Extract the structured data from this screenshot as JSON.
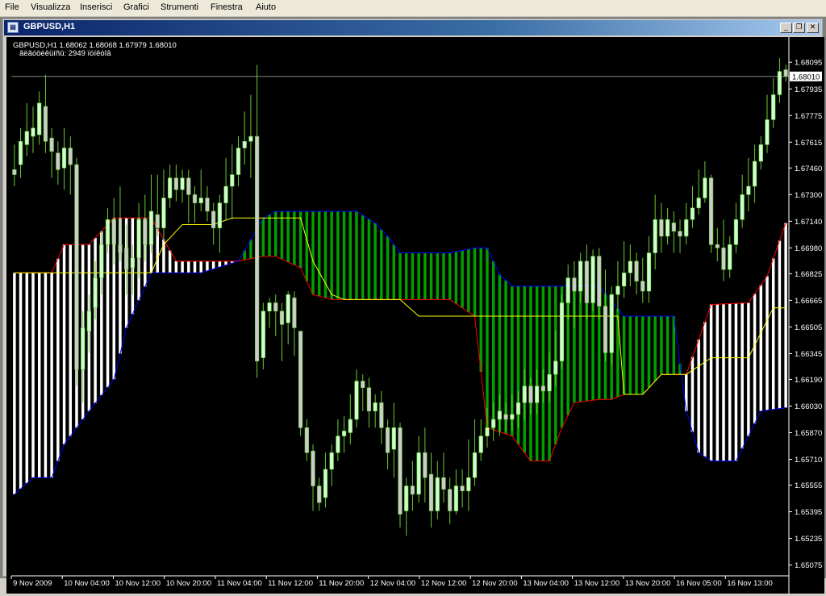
{
  "menu": {
    "items": [
      "File",
      "Visualizza",
      "Inserisci",
      "Grafici",
      "Strumenti",
      "Finestra",
      "Aiuto"
    ]
  },
  "window": {
    "title": "GBPUSD,H1",
    "icon": "chart-window-icon",
    "buttons": [
      {
        "name": "minimize-button",
        "glyph": "_"
      },
      {
        "name": "restore-button",
        "glyph": "❐"
      },
      {
        "name": "close-button",
        "glyph": "✕"
      }
    ]
  },
  "chart_data": {
    "type": "candlestick",
    "symbol": "GBPUSD,H1",
    "ohlc_label": "GBPUSD,H1  1.68062 1.68068 1.67979 1.68010",
    "info_label": "ãëãóöèêüíñû:  2949  ïóíêòîâ",
    "current_price": "1.68010",
    "price_ticks": [
      "1.68095",
      "1.67935",
      "1.67775",
      "1.67615",
      "1.67460",
      "1.67300",
      "1.67140",
      "1.66980",
      "1.66825",
      "1.66665",
      "1.66505",
      "1.66345",
      "1.66190",
      "1.66030",
      "1.65870",
      "1.65710",
      "1.65555",
      "1.65395",
      "1.65235",
      "1.65075"
    ],
    "time_ticks": [
      "9 Nov 2009",
      "10 Nov 04:00",
      "10 Nov 12:00",
      "10 Nov 20:00",
      "11 Nov 04:00",
      "11 Nov 12:00",
      "11 Nov 20:00",
      "12 Nov 04:00",
      "12 Nov 12:00",
      "12 Nov 20:00",
      "13 Nov 04:00",
      "13 Nov 12:00",
      "13 Nov 20:00",
      "16 Nov 05:00",
      "16 Nov 13:00"
    ],
    "ylim": [
      1.6501,
      1.6813
    ],
    "colors": {
      "background": "#000000",
      "bull_candle": "#ccffcc",
      "bear_candle": "#cccccc",
      "wick": "#66cc33",
      "cloud_bull_fill": "#00a000",
      "cloud_bull_edge": "#0000ff",
      "cloud_bear_fill": "#ffffff",
      "cloud_bear_edge": "#ff0000",
      "tenkan": "#ffff00",
      "axis_text": "#ffffff",
      "price_line": "#808080"
    },
    "ichimoku": {
      "tenkan": [
        [
          0,
          1.6683
        ],
        [
          6,
          1.6683
        ],
        [
          12,
          1.6683
        ],
        [
          18,
          1.6683
        ],
        [
          22,
          1.6683
        ],
        [
          24,
          1.67
        ],
        [
          27,
          1.6712
        ],
        [
          32,
          1.6712
        ],
        [
          35,
          1.6716
        ],
        [
          38,
          1.6716
        ],
        [
          42,
          1.6716
        ],
        [
          46,
          1.6716
        ],
        [
          48,
          1.669
        ],
        [
          51,
          1.667
        ],
        [
          53,
          1.6667
        ],
        [
          58,
          1.6667
        ],
        [
          62,
          1.6667
        ],
        [
          65,
          1.6657
        ],
        [
          70,
          1.6657
        ],
        [
          75,
          1.6657
        ],
        [
          80,
          1.6657
        ],
        [
          85,
          1.6657
        ],
        [
          88,
          1.6657
        ],
        [
          92,
          1.6657
        ],
        [
          95,
          1.6657
        ],
        [
          97,
          1.6657
        ],
        [
          98,
          1.661
        ],
        [
          101,
          1.661
        ],
        [
          104,
          1.6622
        ],
        [
          108,
          1.6622
        ],
        [
          112,
          1.6632
        ],
        [
          118,
          1.6632
        ],
        [
          122,
          1.6662
        ],
        [
          124,
          1.6662
        ]
      ],
      "span_a": [
        [
          0,
          1.6683
        ],
        [
          6,
          1.6683
        ],
        [
          8,
          1.67
        ],
        [
          12,
          1.67
        ],
        [
          16,
          1.6716
        ],
        [
          22,
          1.6716
        ],
        [
          26,
          1.669
        ],
        [
          30,
          1.669
        ],
        [
          36,
          1.669
        ],
        [
          40,
          1.6693
        ],
        [
          42,
          1.6693
        ],
        [
          46,
          1.6686
        ],
        [
          48,
          1.667
        ],
        [
          51,
          1.6667
        ],
        [
          54,
          1.6667
        ],
        [
          58,
          1.6667
        ],
        [
          62,
          1.6667
        ],
        [
          66,
          1.6667
        ],
        [
          70,
          1.6667
        ],
        [
          74,
          1.6657
        ],
        [
          76,
          1.659
        ],
        [
          80,
          1.6585
        ],
        [
          83,
          1.657
        ],
        [
          86,
          1.657
        ],
        [
          88,
          1.659
        ],
        [
          90,
          1.6605
        ],
        [
          94,
          1.6607
        ],
        [
          96,
          1.6607
        ],
        [
          98,
          1.661
        ],
        [
          101,
          1.661
        ],
        [
          104,
          1.6622
        ],
        [
          108,
          1.6622
        ],
        [
          112,
          1.6664
        ],
        [
          118,
          1.6665
        ],
        [
          121,
          1.6681
        ],
        [
          124,
          1.6713
        ]
      ],
      "span_b": [
        [
          0,
          1.655
        ],
        [
          3,
          1.656
        ],
        [
          6,
          1.656
        ],
        [
          8,
          1.658
        ],
        [
          12,
          1.66
        ],
        [
          16,
          1.6619
        ],
        [
          18,
          1.665
        ],
        [
          22,
          1.6683
        ],
        [
          26,
          1.6683
        ],
        [
          30,
          1.6683
        ],
        [
          36,
          1.669
        ],
        [
          40,
          1.6716
        ],
        [
          42,
          1.672
        ],
        [
          46,
          1.672
        ],
        [
          50,
          1.672
        ],
        [
          55,
          1.672
        ],
        [
          58,
          1.6713
        ],
        [
          60,
          1.6705
        ],
        [
          62,
          1.6695
        ],
        [
          66,
          1.6695
        ],
        [
          70,
          1.6695
        ],
        [
          74,
          1.6698
        ],
        [
          76,
          1.6698
        ],
        [
          78,
          1.6682
        ],
        [
          80,
          1.6675
        ],
        [
          86,
          1.6675
        ],
        [
          90,
          1.6675
        ],
        [
          94,
          1.6675
        ],
        [
          98,
          1.6657
        ],
        [
          104,
          1.6657
        ],
        [
          106,
          1.6657
        ],
        [
          108,
          1.66
        ],
        [
          110,
          1.6575
        ],
        [
          112,
          1.657
        ],
        [
          114,
          1.657
        ],
        [
          116,
          1.657
        ],
        [
          118,
          1.6585
        ],
        [
          120,
          1.66
        ],
        [
          122,
          1.6601
        ],
        [
          124,
          1.6602
        ]
      ]
    },
    "candles": [
      [
        0,
        1.6745,
        1.6742,
        1.6735,
        1.676
      ],
      [
        1,
        1.6748,
        1.6762,
        1.674,
        1.677
      ],
      [
        2,
        1.676,
        1.6768,
        1.6753,
        1.6785
      ],
      [
        3,
        1.6765,
        1.677,
        1.6755,
        1.6783
      ],
      [
        4,
        1.6766,
        1.6785,
        1.676,
        1.6792
      ],
      [
        5,
        1.6783,
        1.6762,
        1.6755,
        1.6802
      ],
      [
        6,
        1.6764,
        1.6756,
        1.674,
        1.677
      ],
      [
        7,
        1.6755,
        1.6745,
        1.6736,
        1.6762
      ],
      [
        8,
        1.6746,
        1.6758,
        1.6733,
        1.677
      ],
      [
        9,
        1.6758,
        1.6748,
        1.673,
        1.6765
      ],
      [
        10,
        1.6748,
        1.6625,
        1.6615,
        1.6752
      ],
      [
        11,
        1.6625,
        1.665,
        1.6605,
        1.666
      ],
      [
        12,
        1.6648,
        1.666,
        1.6635,
        1.667
      ],
      [
        13,
        1.6662,
        1.668,
        1.6655,
        1.669
      ],
      [
        14,
        1.668,
        1.67,
        1.667,
        1.6708
      ],
      [
        15,
        1.67,
        1.6715,
        1.6695,
        1.6722
      ],
      [
        16,
        1.6715,
        1.67,
        1.6688,
        1.6728
      ],
      [
        17,
        1.67,
        1.6695,
        1.669,
        1.6735
      ],
      [
        18,
        1.6698,
        1.6685,
        1.667,
        1.6712
      ],
      [
        19,
        1.6686,
        1.6692,
        1.667,
        1.67
      ],
      [
        20,
        1.6692,
        1.6715,
        1.668,
        1.6725
      ],
      [
        21,
        1.6715,
        1.67,
        1.669,
        1.673
      ],
      [
        22,
        1.67,
        1.672,
        1.6695,
        1.6742
      ],
      [
        23,
        1.6718,
        1.671,
        1.6705,
        1.6742
      ],
      [
        24,
        1.671,
        1.6728,
        1.6702,
        1.6745
      ],
      [
        25,
        1.6728,
        1.674,
        1.6722,
        1.6748
      ],
      [
        26,
        1.674,
        1.6733,
        1.6726,
        1.6748
      ],
      [
        27,
        1.6733,
        1.674,
        1.6725,
        1.6745
      ],
      [
        28,
        1.674,
        1.673,
        1.6713,
        1.6745
      ],
      [
        29,
        1.673,
        1.6725,
        1.6713,
        1.6735
      ],
      [
        30,
        1.6725,
        1.6728,
        1.672,
        1.6745
      ],
      [
        31,
        1.6728,
        1.672,
        1.6714,
        1.6735
      ],
      [
        32,
        1.672,
        1.671,
        1.67,
        1.6725
      ],
      [
        33,
        1.671,
        1.6725,
        1.6695,
        1.673
      ],
      [
        34,
        1.6725,
        1.6735,
        1.6715,
        1.6752
      ],
      [
        35,
        1.6735,
        1.6742,
        1.6715,
        1.676
      ],
      [
        36,
        1.6742,
        1.6758,
        1.6735,
        1.6765
      ],
      [
        37,
        1.6758,
        1.6762,
        1.6748,
        1.678
      ],
      [
        38,
        1.6762,
        1.6765,
        1.674,
        1.679
      ],
      [
        39,
        1.6765,
        1.663,
        1.662,
        1.6808
      ],
      [
        40,
        1.6632,
        1.666,
        1.6625,
        1.6665
      ],
      [
        41,
        1.666,
        1.6665,
        1.665,
        1.6668
      ],
      [
        42,
        1.6665,
        1.666,
        1.6645,
        1.667
      ],
      [
        43,
        1.666,
        1.6652,
        1.663,
        1.6665
      ],
      [
        44,
        1.6653,
        1.667,
        1.664,
        1.6672
      ],
      [
        45,
        1.6668,
        1.665,
        1.6633,
        1.6672
      ],
      [
        46,
        1.6648,
        1.659,
        1.6585,
        1.6648
      ],
      [
        47,
        1.659,
        1.6575,
        1.657,
        1.6595
      ],
      [
        48,
        1.6576,
        1.6555,
        1.654,
        1.658
      ],
      [
        49,
        1.6555,
        1.6545,
        1.654,
        1.656
      ],
      [
        50,
        1.6548,
        1.6565,
        1.6542,
        1.6575
      ],
      [
        51,
        1.6565,
        1.6575,
        1.6555,
        1.658
      ],
      [
        52,
        1.6575,
        1.6585,
        1.657,
        1.6595
      ],
      [
        53,
        1.6585,
        1.6588,
        1.6575,
        1.6597
      ],
      [
        54,
        1.6587,
        1.6595,
        1.658,
        1.661
      ],
      [
        55,
        1.6595,
        1.6618,
        1.659,
        1.6625
      ],
      [
        56,
        1.6618,
        1.6614,
        1.66,
        1.6622
      ],
      [
        57,
        1.6614,
        1.66,
        1.659,
        1.662
      ],
      [
        58,
        1.66,
        1.6605,
        1.659,
        1.661
      ],
      [
        59,
        1.6605,
        1.659,
        1.658,
        1.6612
      ],
      [
        60,
        1.659,
        1.6575,
        1.6565,
        1.6595
      ],
      [
        61,
        1.6577,
        1.659,
        1.656,
        1.6605
      ],
      [
        62,
        1.659,
        1.6538,
        1.653,
        1.6593
      ],
      [
        63,
        1.654,
        1.6555,
        1.6525,
        1.656
      ],
      [
        64,
        1.6555,
        1.655,
        1.654,
        1.657
      ],
      [
        65,
        1.655,
        1.6575,
        1.6545,
        1.6585
      ],
      [
        66,
        1.6575,
        1.656,
        1.6545,
        1.659
      ],
      [
        67,
        1.6562,
        1.654,
        1.653,
        1.6575
      ],
      [
        68,
        1.654,
        1.656,
        1.6535,
        1.657
      ],
      [
        69,
        1.656,
        1.6553,
        1.6545,
        1.6575
      ],
      [
        70,
        1.6553,
        1.654,
        1.6532,
        1.656
      ],
      [
        71,
        1.654,
        1.6555,
        1.6538,
        1.6565
      ],
      [
        72,
        1.6555,
        1.6552,
        1.6542,
        1.6565
      ],
      [
        73,
        1.6552,
        1.656,
        1.654,
        1.6583
      ],
      [
        74,
        1.656,
        1.6575,
        1.6555,
        1.6595
      ],
      [
        75,
        1.6575,
        1.6585,
        1.657,
        1.6595
      ],
      [
        76,
        1.6585,
        1.659,
        1.6578,
        1.6602
      ],
      [
        77,
        1.659,
        1.6595,
        1.6582,
        1.6605
      ],
      [
        78,
        1.6595,
        1.66,
        1.6585,
        1.661
      ],
      [
        79,
        1.6598,
        1.6595,
        1.6588,
        1.6605
      ],
      [
        80,
        1.6595,
        1.6598,
        1.6588,
        1.661
      ],
      [
        81,
        1.6598,
        1.6605,
        1.659,
        1.6612
      ],
      [
        82,
        1.6605,
        1.6615,
        1.6595,
        1.6625
      ],
      [
        83,
        1.6615,
        1.6605,
        1.6598,
        1.662
      ],
      [
        84,
        1.6605,
        1.6615,
        1.6598,
        1.6625
      ],
      [
        85,
        1.6615,
        1.6612,
        1.6605,
        1.6625
      ],
      [
        86,
        1.6612,
        1.6622,
        1.6605,
        1.6635
      ],
      [
        87,
        1.6622,
        1.663,
        1.6615,
        1.6648
      ],
      [
        88,
        1.663,
        1.6665,
        1.6625,
        1.667
      ],
      [
        89,
        1.6665,
        1.668,
        1.6655,
        1.6688
      ],
      [
        90,
        1.668,
        1.6672,
        1.665,
        1.669
      ],
      [
        91,
        1.6672,
        1.669,
        1.6665,
        1.6695
      ],
      [
        92,
        1.669,
        1.6665,
        1.6655,
        1.67
      ],
      [
        93,
        1.6665,
        1.6693,
        1.666,
        1.6697
      ],
      [
        94,
        1.6693,
        1.6663,
        1.6655,
        1.6698
      ],
      [
        95,
        1.6663,
        1.6635,
        1.663,
        1.6685
      ],
      [
        96,
        1.6635,
        1.667,
        1.6628,
        1.6675
      ],
      [
        97,
        1.667,
        1.6675,
        1.666,
        1.669
      ],
      [
        98,
        1.6675,
        1.6683,
        1.6668,
        1.6702
      ],
      [
        99,
        1.6683,
        1.669,
        1.6675,
        1.67
      ],
      [
        100,
        1.669,
        1.6678,
        1.667,
        1.6695
      ],
      [
        101,
        1.6678,
        1.6672,
        1.6665,
        1.6692
      ],
      [
        102,
        1.6672,
        1.6695,
        1.6665,
        1.6705
      ],
      [
        103,
        1.6695,
        1.6715,
        1.6685,
        1.673
      ],
      [
        104,
        1.6715,
        1.6705,
        1.6695,
        1.6725
      ],
      [
        105,
        1.6705,
        1.6715,
        1.67,
        1.6722
      ],
      [
        106,
        1.6713,
        1.6708,
        1.6695,
        1.672
      ],
      [
        107,
        1.6708,
        1.6705,
        1.6695,
        1.6715
      ],
      [
        108,
        1.6705,
        1.6715,
        1.67,
        1.6725
      ],
      [
        109,
        1.6715,
        1.6722,
        1.671,
        1.6735
      ],
      [
        110,
        1.6722,
        1.6728,
        1.6718,
        1.6745
      ],
      [
        111,
        1.6728,
        1.674,
        1.6725,
        1.675
      ],
      [
        112,
        1.674,
        1.67,
        1.6695,
        1.6742
      ],
      [
        113,
        1.67,
        1.6698,
        1.669,
        1.671
      ],
      [
        114,
        1.6698,
        1.6685,
        1.6678,
        1.6715
      ],
      [
        115,
        1.6685,
        1.67,
        1.668,
        1.6705
      ],
      [
        116,
        1.67,
        1.6715,
        1.6695,
        1.6725
      ],
      [
        117,
        1.6715,
        1.673,
        1.671,
        1.6742
      ],
      [
        118,
        1.673,
        1.6735,
        1.672,
        1.6752
      ],
      [
        119,
        1.6735,
        1.675,
        1.6725,
        1.676
      ],
      [
        120,
        1.675,
        1.676,
        1.6745,
        1.6765
      ],
      [
        121,
        1.676,
        1.6775,
        1.6755,
        1.679
      ],
      [
        122,
        1.6775,
        1.679,
        1.677,
        1.68
      ],
      [
        123,
        1.679,
        1.6804,
        1.6785,
        1.6812
      ],
      [
        124,
        1.6805,
        1.6801,
        1.6798,
        1.6808
      ]
    ]
  }
}
